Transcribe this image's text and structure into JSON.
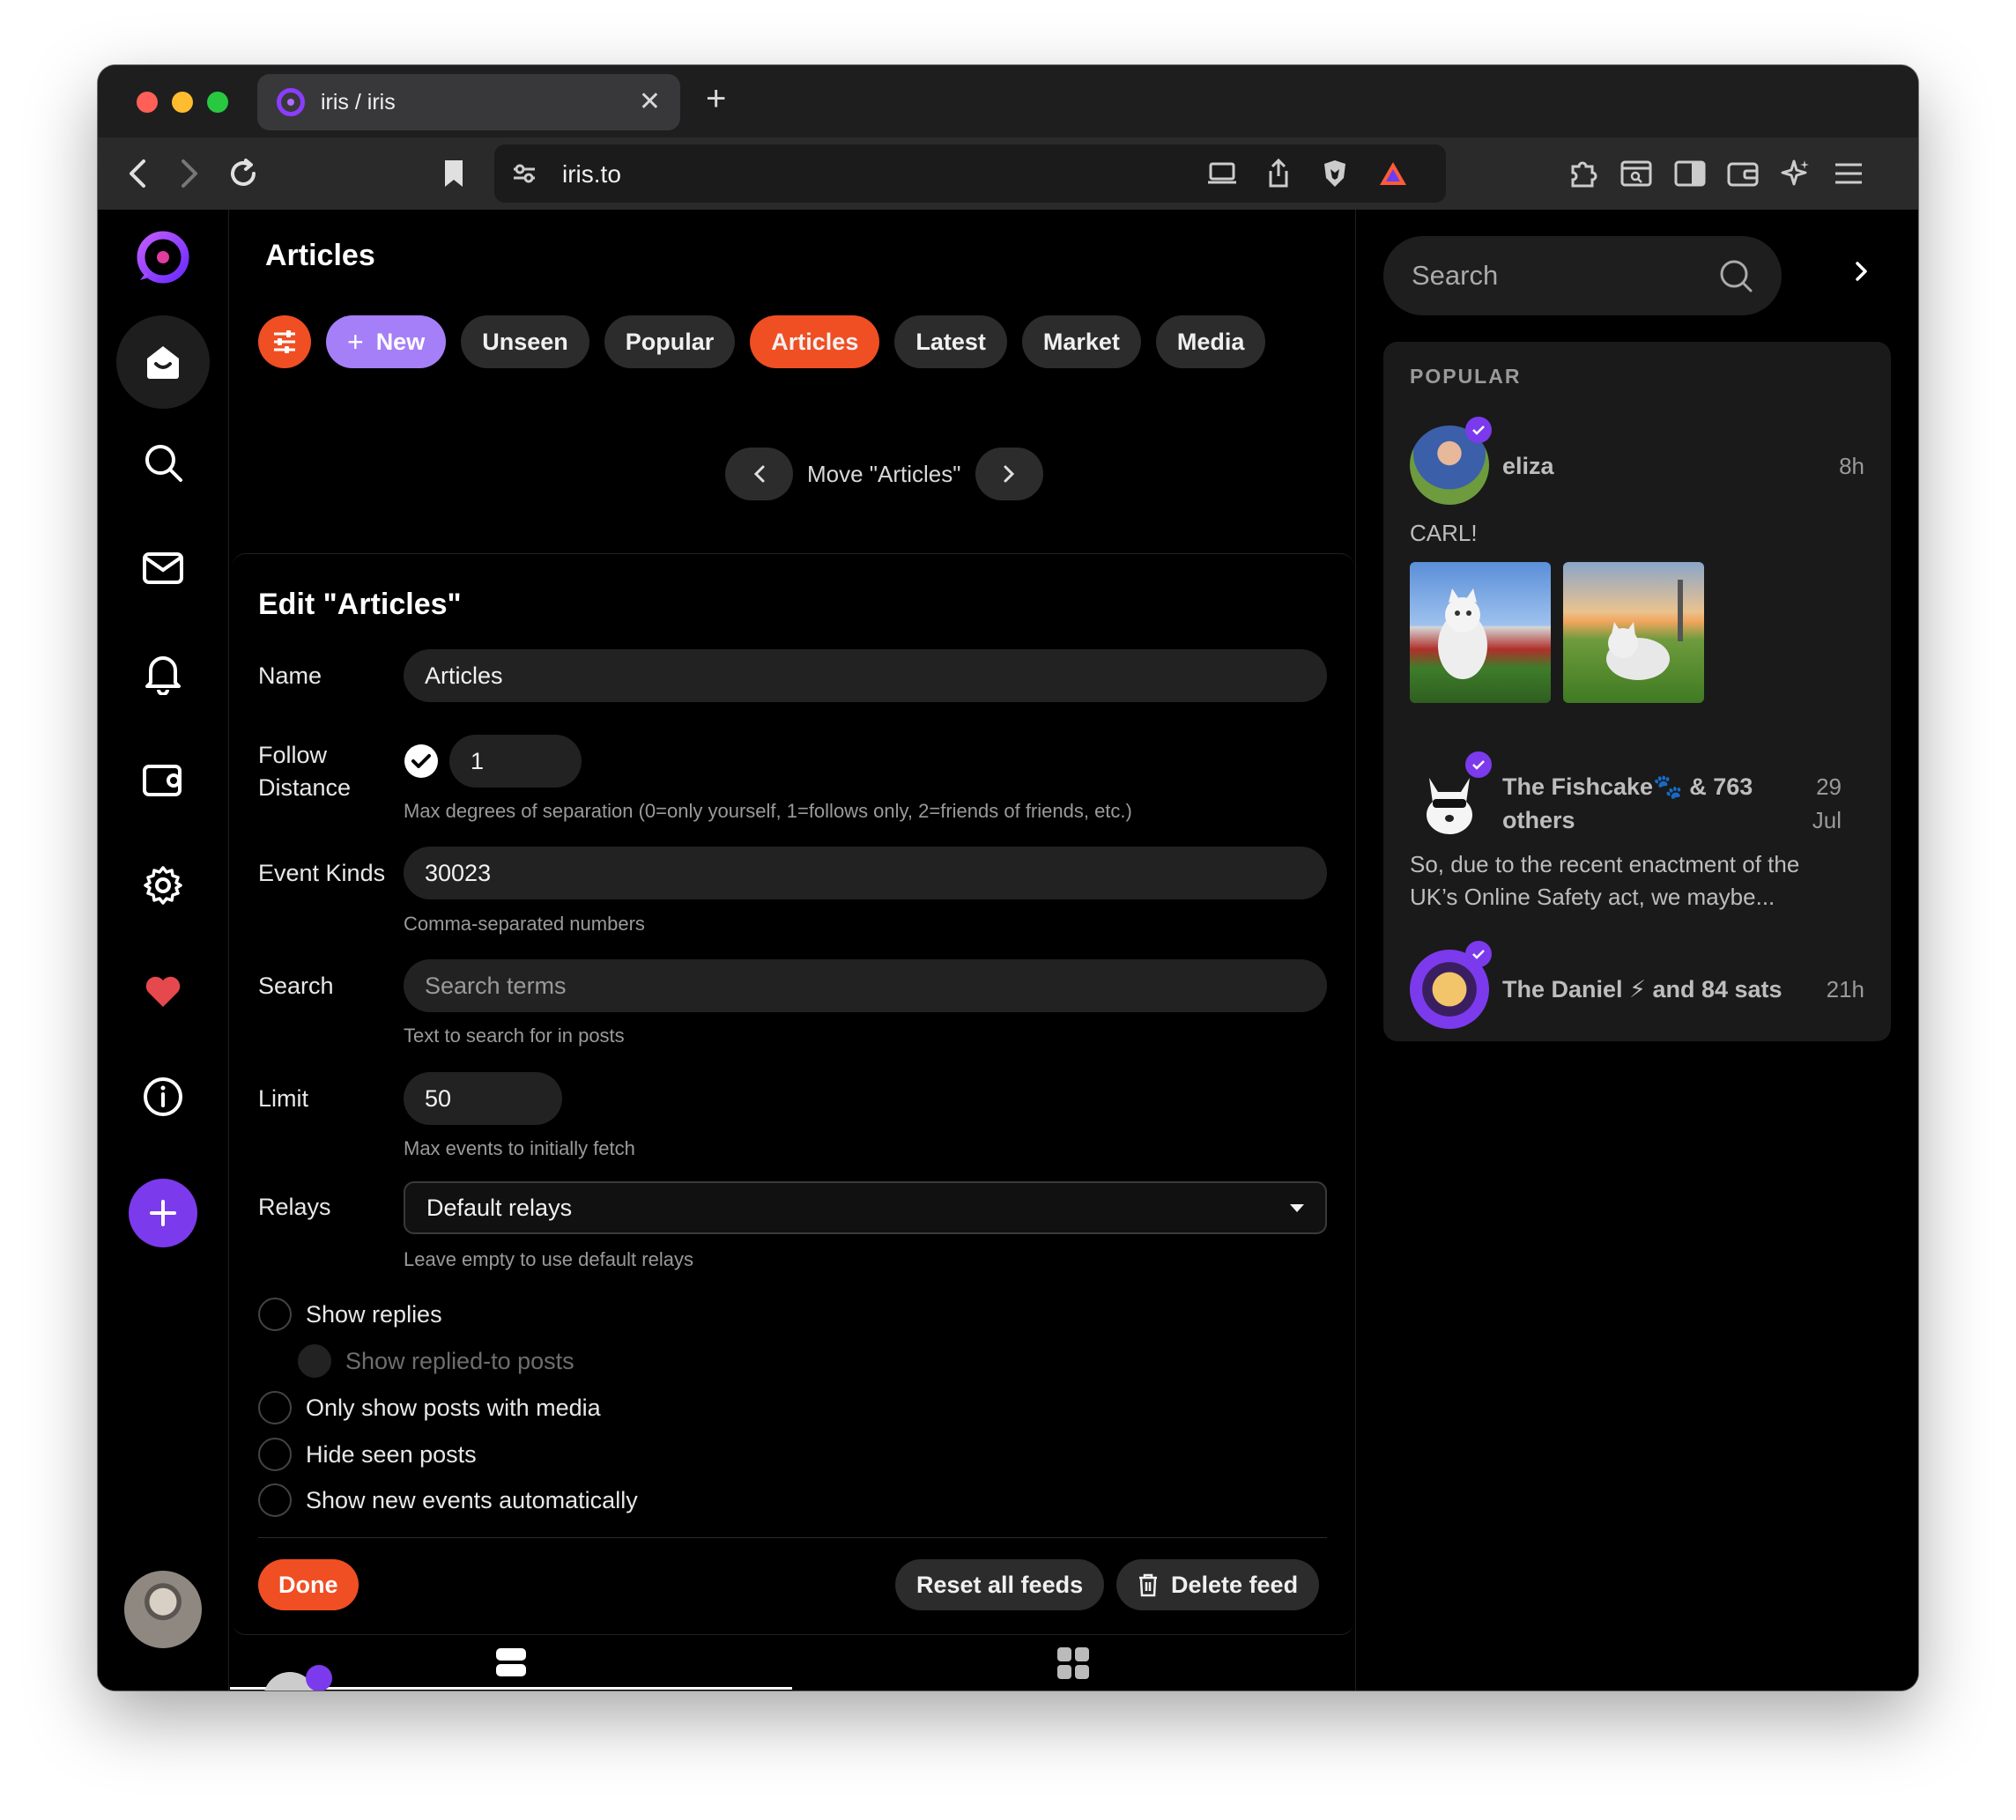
{
  "browser": {
    "tab_title": "iris / iris",
    "url": "iris.to"
  },
  "main": {
    "page_title": "Articles",
    "feed_pills": [
      {
        "label": "New"
      },
      {
        "label": "Unseen"
      },
      {
        "label": "Popular"
      },
      {
        "label": "Articles"
      },
      {
        "label": "Latest"
      },
      {
        "label": "Market"
      },
      {
        "label": "Media"
      }
    ],
    "move_label": "Move \"Articles\""
  },
  "edit": {
    "title": "Edit \"Articles\"",
    "name_label": "Name",
    "name_value": "Articles",
    "follow_label_1": "Follow",
    "follow_label_2": "Distance",
    "follow_value": "1",
    "follow_help": "Max degrees of separation (0=only yourself, 1=follows only, 2=friends of friends, etc.)",
    "kinds_label": "Event Kinds",
    "kinds_value": "30023",
    "kinds_help": "Comma-separated numbers",
    "search_label": "Search",
    "search_placeholder": "Search terms",
    "search_help": "Text to search for in posts",
    "limit_label": "Limit",
    "limit_value": "50",
    "limit_help": "Max events to initially fetch",
    "relays_label": "Relays",
    "relays_value": "Default relays",
    "relays_help": "Leave empty to use default relays",
    "options": {
      "show_replies": "Show replies",
      "show_replied_to": "Show replied-to posts",
      "only_media": "Only show posts with media",
      "hide_seen": "Hide seen posts",
      "show_new_auto": "Show new events automatically"
    },
    "done_label": "Done",
    "reset_label": "Reset all feeds",
    "delete_label": "Delete feed"
  },
  "right": {
    "search_placeholder": "Search",
    "popular_heading": "POPULAR",
    "posts": [
      {
        "name": "eliza",
        "time": "8h",
        "text": "CARL!"
      },
      {
        "name_1": "The Fishcake🐾 & 763",
        "name_2": "others",
        "time_1": "29",
        "time_2": "Jul",
        "text_1": "So, due to the recent enactment of the",
        "text_2": "UK’s Online Safety act, we maybe..."
      },
      {
        "name": "The Daniel ⚡ and 84 sats",
        "time": "21h"
      }
    ]
  },
  "colors": {
    "accent": "#f04e23",
    "purple": "#7c3aed",
    "new_pill": "#a57ff7",
    "background": "#000000"
  }
}
